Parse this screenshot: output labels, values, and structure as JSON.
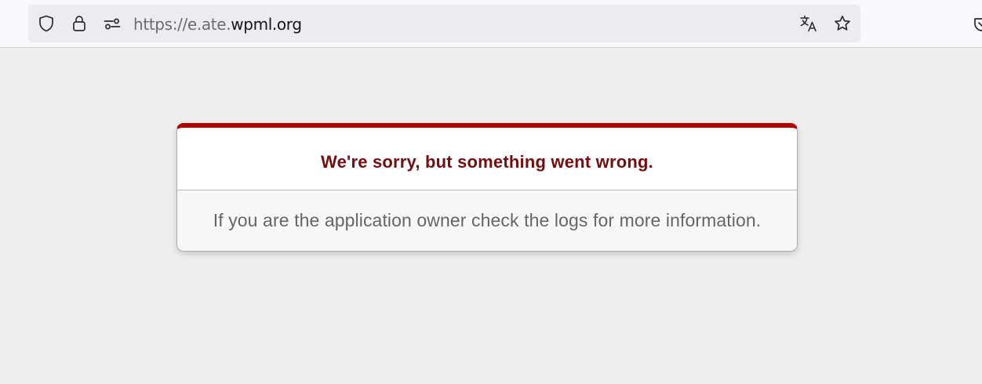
{
  "browser": {
    "url_prefix": "https://e.ate.",
    "url_domain": "wpml.org",
    "icons": {
      "shield": "tracking-protection-shield-icon",
      "lock": "secure-connection-lock-icon",
      "permissions": "site-permissions-icon",
      "translate": "translate-page-icon",
      "bookmark": "bookmark-star-icon",
      "extension": "pocket-extension-icon"
    }
  },
  "error": {
    "title": "We're sorry, but something went wrong.",
    "message": "If you are the application owner check the logs for more information."
  },
  "colors": {
    "page_background": "#efeeee",
    "accent_red": "#b00100",
    "title_color": "#730d0e",
    "message_color": "#656565"
  }
}
